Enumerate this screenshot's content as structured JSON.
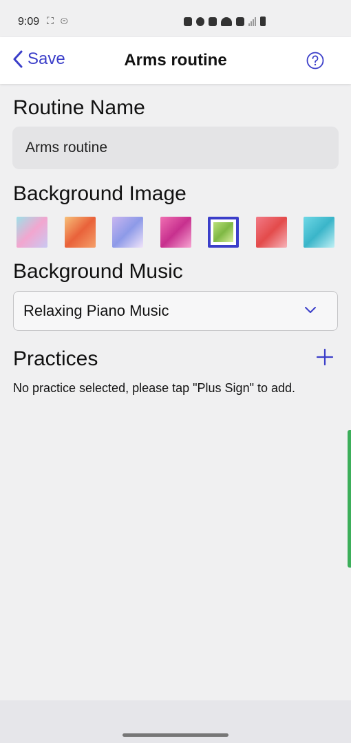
{
  "status_bar": {
    "time": "9:09",
    "left_icons": "⛶ ⊝"
  },
  "nav": {
    "back_label": "Save",
    "title": "Arms routine",
    "accent_color": "#3b3ec9"
  },
  "routine_name": {
    "heading": "Routine Name",
    "value": "Arms routine"
  },
  "background_image": {
    "heading": "Background Image",
    "selected_index": 4,
    "thumbnails": [
      {
        "name": "teal-pink",
        "colors": [
          "#9ee0e8",
          "#f2a6cf",
          "#c9c9f2"
        ]
      },
      {
        "name": "orange",
        "colors": [
          "#f7c07a",
          "#e9623a",
          "#f5a06a"
        ]
      },
      {
        "name": "lavender",
        "colors": [
          "#c9b6f0",
          "#8d9ae8",
          "#f1e4fa"
        ]
      },
      {
        "name": "magenta",
        "colors": [
          "#f06fb2",
          "#c7308e",
          "#f7a4d2"
        ]
      },
      {
        "name": "lime",
        "colors": [
          "#b9e07a",
          "#7fb844",
          "#d8ef9c"
        ]
      },
      {
        "name": "coral",
        "colors": [
          "#f27a86",
          "#e34b4b",
          "#f7b3b9"
        ]
      },
      {
        "name": "cyan",
        "colors": [
          "#6fd8e6",
          "#3ab5c9",
          "#bff0f5"
        ]
      }
    ]
  },
  "background_music": {
    "heading": "Background Music",
    "selected": "Relaxing Piano Music"
  },
  "practices": {
    "heading": "Practices",
    "empty_message": "No practice selected, please tap \"Plus Sign\" to add."
  }
}
